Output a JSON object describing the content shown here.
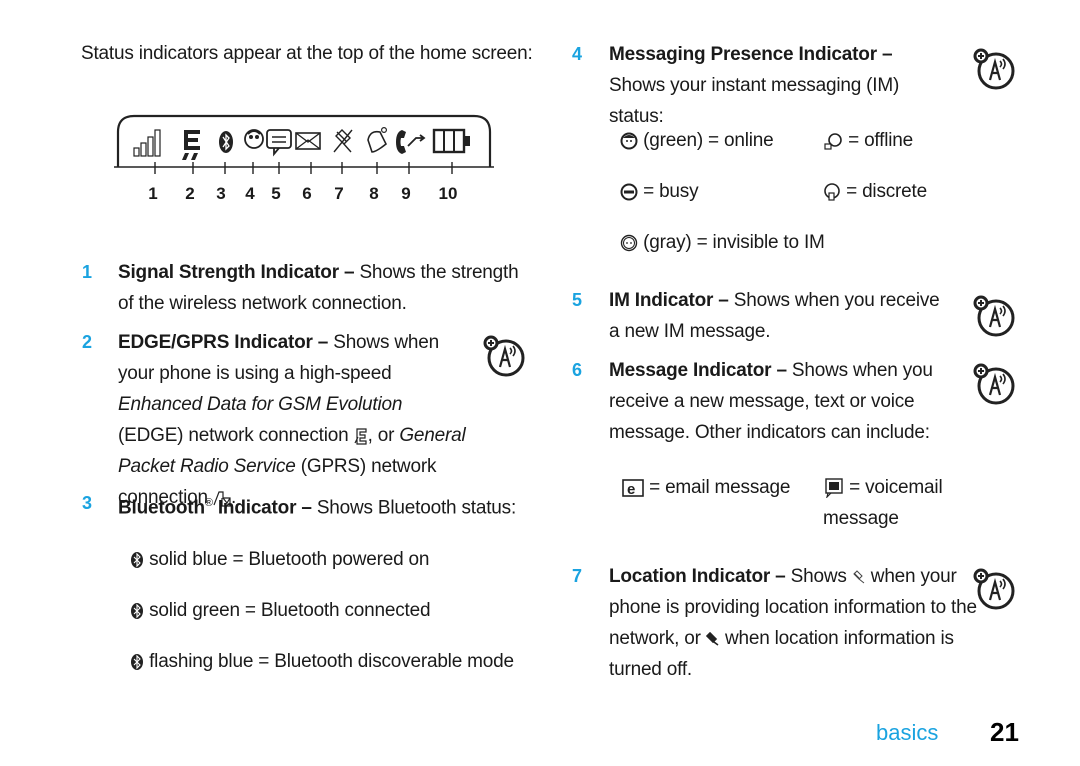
{
  "intro": "Status indicators appear at the top of the home screen:",
  "diagram": {
    "callouts": [
      "1",
      "2",
      "3",
      "4",
      "5",
      "6",
      "7",
      "8",
      "9",
      "10"
    ],
    "icons": [
      "signal-strength-icon",
      "edge-gprs-icon",
      "bluetooth-icon",
      "messaging-presence-icon",
      "im-icon",
      "message-icon",
      "location-icon",
      "alert-icon",
      "active-line-icon",
      "battery-icon"
    ]
  },
  "items": [
    {
      "num": "1",
      "title": "Signal Strength Indicator –",
      "text": " Shows the strength of the wireless network connection."
    },
    {
      "num": "2",
      "title": "EDGE/GPRS Indicator –",
      "text1": " Shows when your phone is using a high-speed ",
      "em1": "Enhanced Data for GSM Evolution",
      "text2": " (EDGE) network connection ",
      "text3": ", or ",
      "em2": "General Packet Radio Service",
      "text4": " (GPRS) network connection ",
      "text5": "."
    },
    {
      "num": "3",
      "title": "Bluetooth",
      "reg": "®",
      "title2": " Indicator –",
      "text": " Shows Bluetooth status:"
    },
    {
      "num": "4",
      "title": "Messaging Presence Indicator –",
      "text": " Shows your instant messaging (IM) status:"
    },
    {
      "num": "5",
      "title": "IM Indicator –",
      "text": " Shows when you receive a new IM message."
    },
    {
      "num": "6",
      "title": "Message Indicator –",
      "text": " Shows when you receive a new message, text or voice message. Other indicators can include:"
    },
    {
      "num": "7",
      "title": "Location Indicator –",
      "text1": " Shows ",
      "text2": " when your phone is providing location information to the network, or ",
      "text3": " when location information is turned off."
    }
  ],
  "bluetooth_states": [
    "solid blue = Bluetooth powered on",
    "solid green = Bluetooth connected",
    "flashing blue = Bluetooth discoverable mode"
  ],
  "presence_states": {
    "online": "(green) = online",
    "offline": "= offline",
    "busy": "= busy",
    "discrete": "= discrete",
    "invisible": "(gray) = invisible to IM"
  },
  "message_types": {
    "email": "= email message",
    "voicemail_1": "= voicemail",
    "voicemail_2": "message"
  },
  "footer": {
    "section": "basics",
    "page": "21"
  },
  "colors": {
    "accent": "#1aa3e0",
    "text": "#1a1a1a"
  }
}
